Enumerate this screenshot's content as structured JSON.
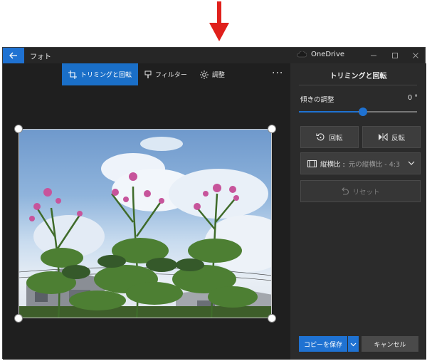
{
  "app": {
    "title": "フォト",
    "onedrive": "OneDrive"
  },
  "toolbar": {
    "crop_rotate": "トリミングと回転",
    "filters": "フィルター",
    "adjust": "調整",
    "more": "···"
  },
  "panel": {
    "title": "トリミングと回転",
    "straighten_label": "傾きの調整",
    "straighten_value": "0 °",
    "straighten_fraction": 0.5,
    "rotate_label": "回転",
    "flip_label": "反転",
    "aspect_label": "縦横比 :",
    "aspect_value": "元の縦横比 - 4:3",
    "reset_label": "リセット",
    "save_copy_label": "コピーを保存",
    "cancel_label": "キャンセル"
  },
  "colors": {
    "accent": "#1f72d2",
    "arrow": "#e0201c",
    "panel_bg": "#2b2b2b",
    "canvas_bg": "#1f1f1f"
  }
}
